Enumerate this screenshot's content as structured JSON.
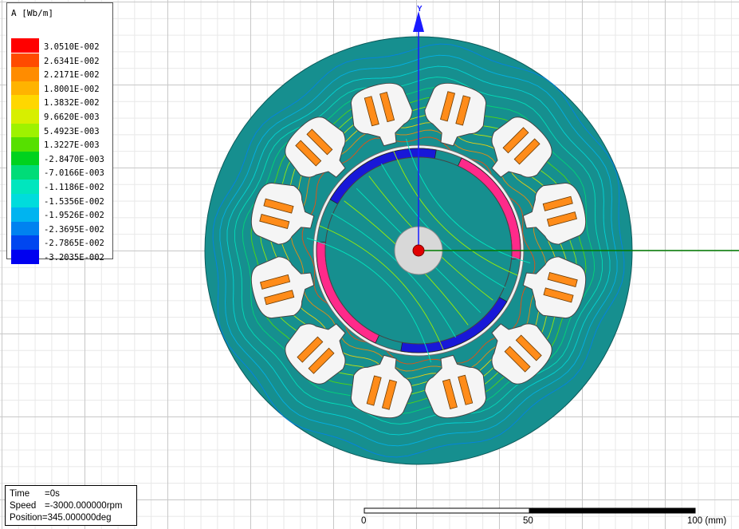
{
  "legend": {
    "title": "A [Wb/m]",
    "entries": [
      {
        "label": "3.0510E-002",
        "color": "#ff0000"
      },
      {
        "label": "2.6341E-002",
        "color": "#ff4a00"
      },
      {
        "label": "2.2171E-002",
        "color": "#ff8c00"
      },
      {
        "label": "1.8001E-002",
        "color": "#ffb300"
      },
      {
        "label": "1.3832E-002",
        "color": "#ffd700"
      },
      {
        "label": "9.6620E-003",
        "color": "#d7ef00"
      },
      {
        "label": "5.4923E-003",
        "color": "#9ef200"
      },
      {
        "label": "1.3227E-003",
        "color": "#56e000"
      },
      {
        "label": "-2.8470E-003",
        "color": "#00d21e"
      },
      {
        "label": "-7.0166E-003",
        "color": "#00dc78"
      },
      {
        "label": "-1.1186E-002",
        "color": "#00e6be"
      },
      {
        "label": "-1.5356E-002",
        "color": "#00dcdc"
      },
      {
        "label": "-1.9526E-002",
        "color": "#00b4f0"
      },
      {
        "label": "-2.3695E-002",
        "color": "#0082f0"
      },
      {
        "label": "-2.7865E-002",
        "color": "#0046f0"
      },
      {
        "label": "-3.2035E-002",
        "color": "#0000f0"
      }
    ]
  },
  "status": {
    "time_key": "Time",
    "time_value": "=0s",
    "speed_key": "Speed",
    "speed_value": "=-3000.000000rpm",
    "position_key": "Position",
    "position_value": "=345.000000deg"
  },
  "axis": {
    "y_label": "Y"
  },
  "scale_bar": {
    "tick_0": "0",
    "tick_50": "50",
    "tick_100": "100 (mm)"
  },
  "colors": {
    "stator": "#168f8f",
    "slot": "#f5f5f5",
    "coil": "#ff8c1a",
    "magnet_north": "#ff2a8a",
    "magnet_south": "#1818d8",
    "shaft": "#d8d8d8",
    "y_axis": "#1a1aff",
    "x_axis": "#007a00"
  },
  "model": {
    "slot_count": 12,
    "slot_offset_deg": 15
  }
}
